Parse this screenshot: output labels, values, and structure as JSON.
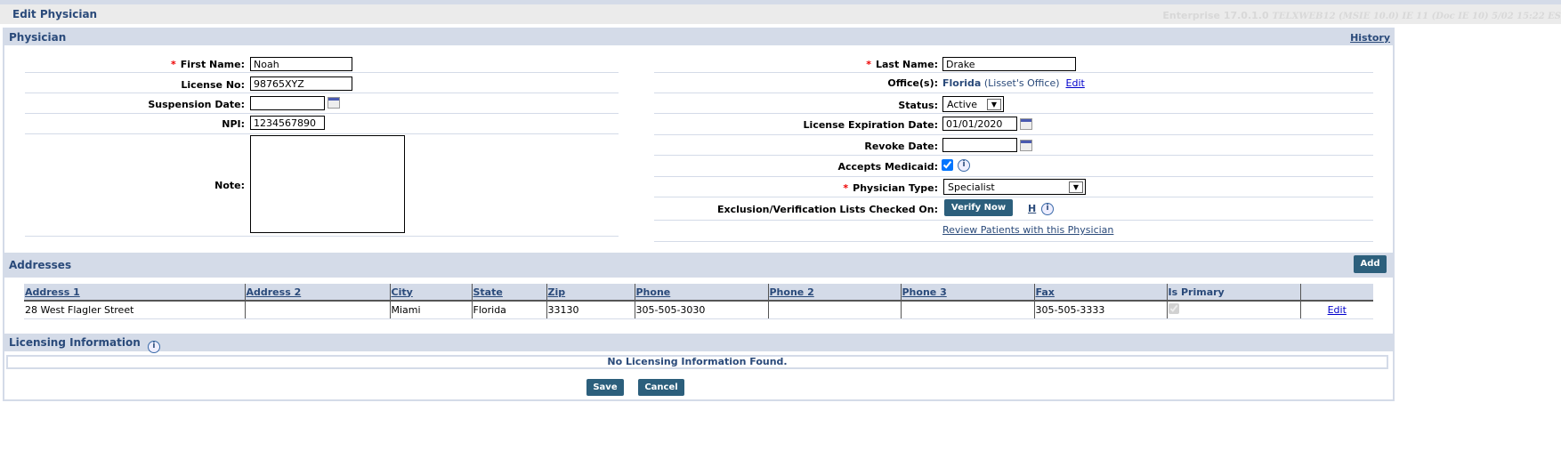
{
  "header": {
    "title": "Edit Physician",
    "version": "Enterprise 17.0.1.0",
    "env": "TELXWEB12 (MSIE 10.0) IE 11 (Doc IE 10) 5/02 15:22 ES"
  },
  "physician": {
    "section_title": "Physician",
    "history_link": "History",
    "first_name_label": "First Name:",
    "first_name": "Noah",
    "license_no_label": "License No:",
    "license_no": "98765XYZ",
    "suspension_date_label": "Suspension Date:",
    "suspension_date": "",
    "npi_label": "NPI:",
    "npi": "1234567890",
    "note_label": "Note:",
    "note": "",
    "last_name_label": "Last Name:",
    "last_name": "Drake",
    "offices_label": "Office(s):",
    "office_name": "Florida",
    "office_detail": "(Lisset's Office)",
    "office_edit": "Edit",
    "status_label": "Status:",
    "status": "Active",
    "license_exp_label": "License Expiration Date:",
    "license_exp": "01/01/2020",
    "revoke_date_label": "Revoke Date:",
    "revoke_date": "",
    "accepts_medicaid_label": "Accepts Medicaid:",
    "accepts_medicaid": true,
    "physician_type_label": "Physician Type:",
    "physician_type": "Specialist",
    "exclusion_label": "Exclusion/Verification Lists Checked On:",
    "verify_now": "Verify Now",
    "h_link": "H",
    "review_patients": "Review Patients with this Physician"
  },
  "addresses": {
    "section_title": "Addresses",
    "add_label": "Add",
    "columns": [
      "Address 1",
      "Address 2",
      "City",
      "State",
      "Zip",
      "Phone",
      "Phone 2",
      "Phone 3",
      "Fax",
      "Is Primary"
    ],
    "rows": [
      {
        "address1": "28 West Flagler Street",
        "address2": "",
        "city": "Miami",
        "state": "Florida",
        "zip": "33130",
        "phone": "305-505-3030",
        "phone2": "",
        "phone3": "",
        "fax": "305-505-3333",
        "is_primary": true,
        "edit": "Edit"
      }
    ]
  },
  "licensing": {
    "section_title": "Licensing Information",
    "empty": "No Licensing Information Found."
  },
  "footer": {
    "save": "Save",
    "cancel": "Cancel"
  }
}
